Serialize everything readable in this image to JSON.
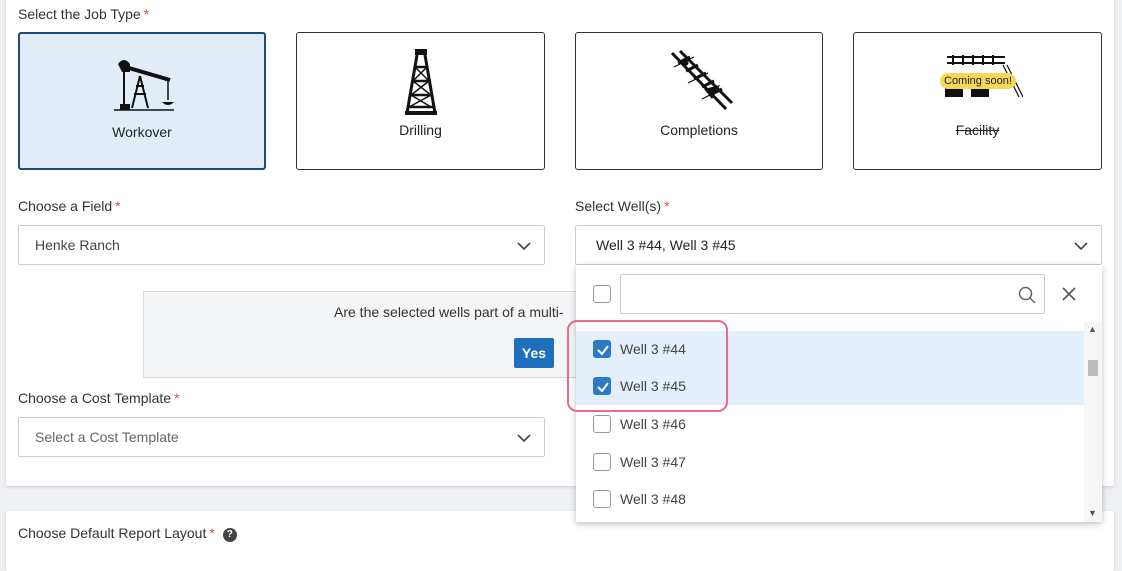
{
  "job_type": {
    "label": "Select the Job Type",
    "required_mark": "*",
    "options": [
      {
        "label": "Workover",
        "icon": "pumpjack-icon",
        "selected": true
      },
      {
        "label": "Drilling",
        "icon": "drilling-rig-icon",
        "selected": false
      },
      {
        "label": "Completions",
        "icon": "completions-icon",
        "selected": false
      },
      {
        "label": "Facility",
        "icon": "facility-icon",
        "selected": false,
        "badge": "Coming soon!",
        "disabled": true
      }
    ]
  },
  "field": {
    "label": "Choose a Field",
    "required_mark": "*",
    "value": "Henke Ranch"
  },
  "wells": {
    "label": "Select Well(s)",
    "required_mark": "*",
    "value": "Well 3 #44, Well 3 #45",
    "dropdown": {
      "search_placeholder": "",
      "items": [
        {
          "label": "Well 3 #44",
          "checked": true
        },
        {
          "label": "Well 3 #45",
          "checked": true
        },
        {
          "label": "Well 3 #46",
          "checked": false
        },
        {
          "label": "Well 3 #47",
          "checked": false
        },
        {
          "label": "Well 3 #48",
          "checked": false
        }
      ]
    }
  },
  "prompt": {
    "text": "Are the selected wells part of a multi-",
    "yes_label": "Yes"
  },
  "cost_template": {
    "label": "Choose a Cost Template",
    "required_mark": "*",
    "placeholder": "Select a Cost Template"
  },
  "report_layout": {
    "label": "Choose Default Report Layout",
    "required_mark": "*",
    "help_icon": "?"
  },
  "colors": {
    "accent": "#2e78c8",
    "selected_bg": "#e2ecf7",
    "selected_border": "#1c4a7a",
    "required": "#e04b4b",
    "highlight": "#e86b8e",
    "badge": "#f7d75a"
  }
}
